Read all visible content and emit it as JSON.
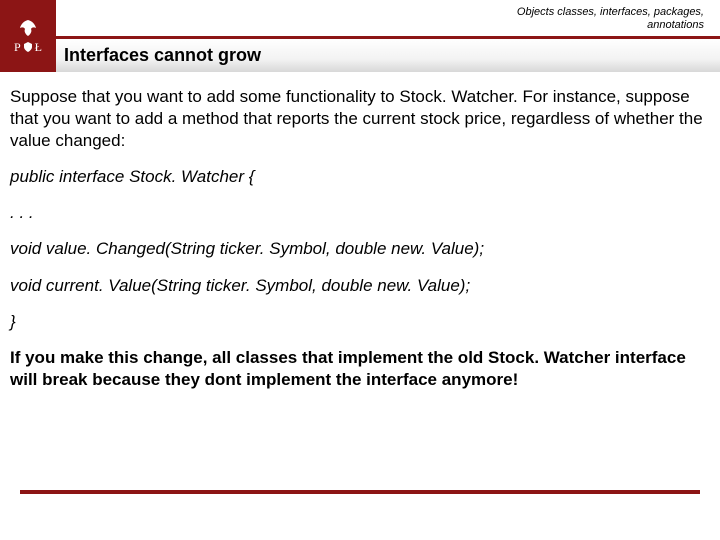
{
  "header": {
    "breadcrumb_l1": "Objects classes, interfaces, packages,",
    "breadcrumb_l2": "annotations",
    "logo_p": "P",
    "logo_l": "Ł",
    "title": "Interfaces cannot grow"
  },
  "content": {
    "intro": "Suppose that you want to add some functionality to Stock. Watcher. For instance, suppose that you want to add a method that reports the current stock price, regardless of whether the value changed:",
    "code1": "public interface Stock. Watcher {",
    "code2": ". . .",
    "code3": "void value. Changed(String ticker. Symbol, double new. Value);",
    "code4": "void current. Value(String ticker. Symbol, double new. Value);",
    "code5": " }",
    "warn": "If you make this change, all classes that implement the old Stock. Watcher interface will break because they dont implement the interface anymore!"
  }
}
